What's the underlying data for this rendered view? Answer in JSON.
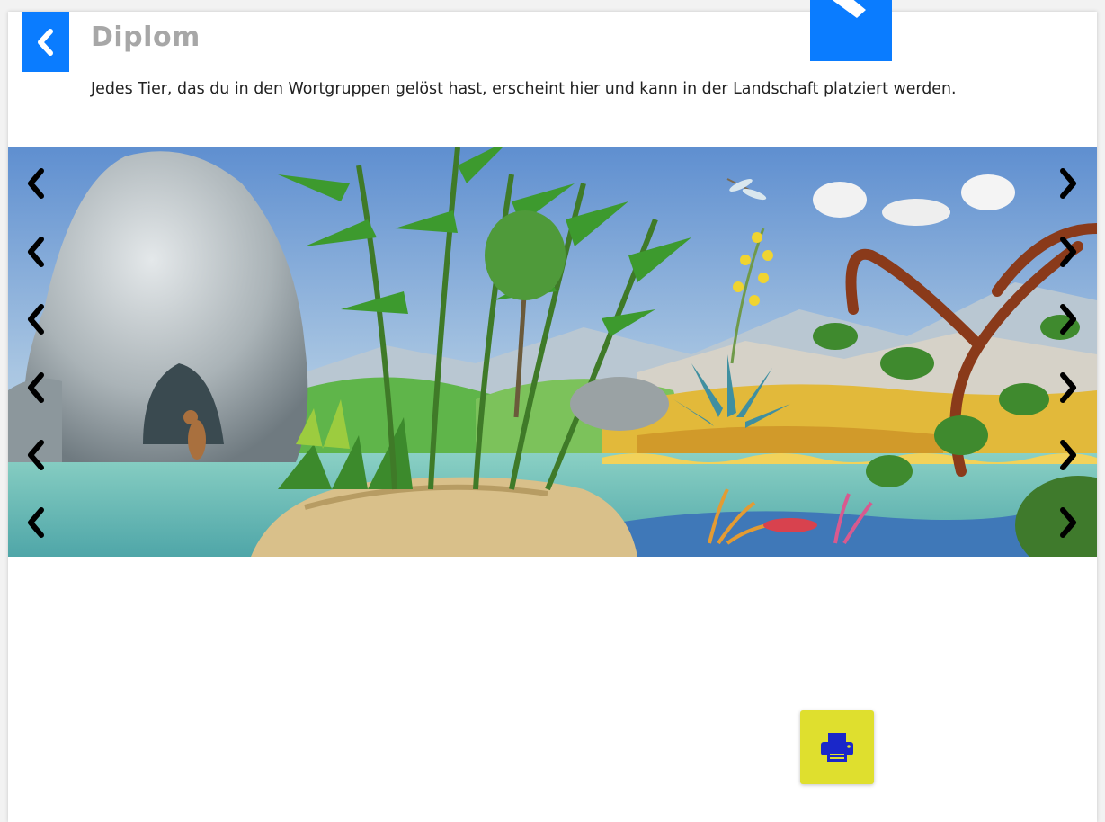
{
  "header": {
    "title": "Diplom",
    "description": "Jedes Tier, das du in den Wortgruppen gelöst hast, erscheint hier und kann in der Landschaft platziert werden.",
    "back_icon": "chevron-left-icon",
    "tool_icon": "pencil-icon"
  },
  "landscape": {
    "scene": "painted landscape with rock cave, bamboo, desert plants, tree and water",
    "arrow_rows": 6,
    "left_arrow_icon": "chevron-left-icon",
    "right_arrow_icon": "chevron-right-icon"
  },
  "actions": {
    "print_icon": "printer-icon"
  },
  "colors": {
    "accent_blue": "#0a7cff",
    "print_yellow": "#dfdf2e",
    "print_icon": "#1a27c9",
    "title_gray": "#a7a7a7"
  }
}
